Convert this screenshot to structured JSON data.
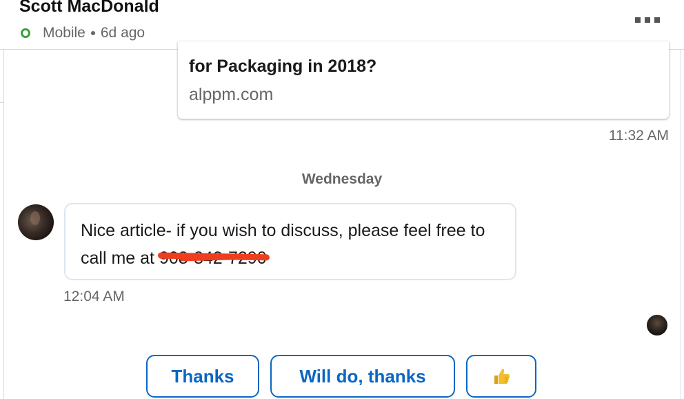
{
  "header": {
    "contact_name": "Scott MacDonald",
    "presence": "Mobile",
    "last_active": "6d ago",
    "presence_color": "#3a9e3e"
  },
  "thread": {
    "link_preview": {
      "title": "for Packaging in 2018?",
      "domain": "alppm.com"
    },
    "sent_time": "11:32 AM",
    "date_divider": "Wednesday",
    "incoming_message": {
      "text_before": "Nice article- if you wish to discuss, please feel free to call me at ",
      "redacted": "908-842-7290",
      "time": "12:04 AM"
    }
  },
  "quick_replies": [
    {
      "label": "Thanks"
    },
    {
      "label": "Will do, thanks"
    },
    {
      "label": "👍",
      "icon": "thumbs-up-icon"
    }
  ],
  "colors": {
    "accent": "#0a66c2",
    "redaction": "#ef3e1f"
  }
}
